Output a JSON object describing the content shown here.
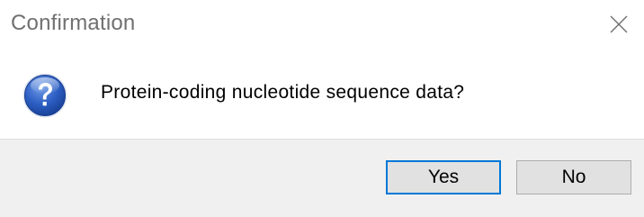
{
  "dialog": {
    "title": "Confirmation",
    "message": "Protein-coding nucleotide sequence data?",
    "icon": "question-icon",
    "close_icon": "close-icon",
    "buttons": {
      "yes_label": "Yes",
      "no_label": "No"
    },
    "colors": {
      "accent": "#0078d7",
      "footer_bg": "#f0f0f0",
      "button_bg": "#e1e1e1",
      "icon_blue": "#2a56b0"
    }
  }
}
